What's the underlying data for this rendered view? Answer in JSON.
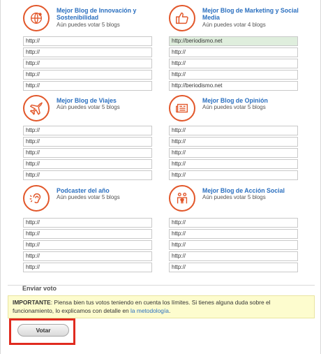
{
  "categories": [
    {
      "id": "innovacion",
      "title": "Mejor Blog de Innovación y Sostenibilidad",
      "subtitle": "Aún puedes votar 5 blogs",
      "icon": "globe-network-icon",
      "urls": [
        "http://",
        "http://",
        "http://",
        "http://",
        "http://"
      ]
    },
    {
      "id": "marketing",
      "title": "Mejor Blog de Marketing y Social Media",
      "subtitle": "Aún puedes votar 4 blogs",
      "icon": "thumbs-up-icon",
      "urls": [
        "http://beriodismo.net",
        "http://",
        "http://",
        "http://",
        "http://beriodismo.net"
      ]
    },
    {
      "id": "viajes",
      "title": "Mejor Blog de Viajes",
      "subtitle": "Aún puedes votar 5 blogs",
      "icon": "airplane-icon",
      "urls": [
        "http://",
        "http://",
        "http://",
        "http://",
        "http://"
      ]
    },
    {
      "id": "opinion",
      "title": "Mejor Blog de Opinión",
      "subtitle": "Aún puedes votar 5 blogs",
      "icon": "newspaper-icon",
      "urls": [
        "http://",
        "http://",
        "http://",
        "http://",
        "http://"
      ]
    },
    {
      "id": "podcaster",
      "title": "Podcaster del año",
      "subtitle": "Aún puedes votar 5 blogs",
      "icon": "ear-icon",
      "urls": [
        "http://",
        "http://",
        "http://",
        "http://",
        "http://"
      ]
    },
    {
      "id": "accion-social",
      "title": "Mejor Blog de Acción Social",
      "subtitle": "Aún puedes votar 5 blogs",
      "icon": "people-heart-icon",
      "urls": [
        "http://",
        "http://",
        "http://",
        "http://",
        "http://"
      ]
    }
  ],
  "enviar": {
    "title": "Enviar voto"
  },
  "notice": {
    "label": "IMPORTANTE",
    "text": ": Piensa bien tus votos teniendo en cuenta los límites. Si tienes alguna duda sobre el funcionamiento, lo explicamos con detalle en ",
    "link_text": "la metodología",
    "end": "."
  },
  "vote_button": {
    "label": "Votar"
  },
  "colors": {
    "accent": "#e2572a",
    "link": "#2a6fbf",
    "highlight_border": "#e02b1f",
    "notice_bg": "#fdfcce"
  }
}
